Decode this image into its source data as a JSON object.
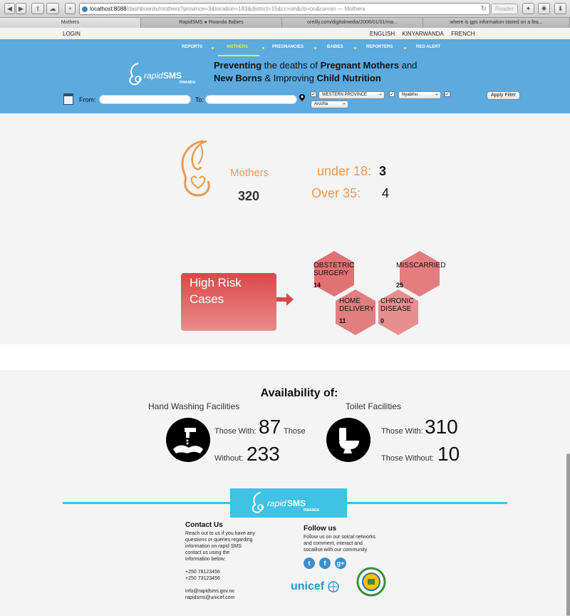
{
  "browser": {
    "url_host": "localhost:8088",
    "url_path": "/dashboards/mothers?province=3&location=183&district=15&cc=on&cb=on&ca=on",
    "page_title": "— Mothers",
    "reader_label": "Reader",
    "tabs": [
      {
        "label": "Mothers"
      },
      {
        "label": "RapidSMS ● Rwanda Babies"
      },
      {
        "label": "oreilly.com/digitalmedia/2006/01/01/ma..."
      },
      {
        "label": "where is gps information stored on a fea..."
      }
    ]
  },
  "topbar": {
    "login": "LOGIN",
    "languages": [
      "ENGLISH",
      "KINYARWANDA",
      "FRENCH"
    ]
  },
  "nav": {
    "items": [
      "REPORTS",
      "MOTHERS",
      "PREGNANCIES",
      "BABIES",
      "REPORTERS",
      "RED ALERT"
    ]
  },
  "logo": {
    "rapid": "rapid",
    "sms": "SMS",
    "rwanda": "RWANDA"
  },
  "tagline": {
    "w1": "Preventing",
    "w2": " the deaths of ",
    "w3": "Pregnant Mothers",
    "w4": " and",
    "w5": "New Borns",
    "w6": " & Improving ",
    "w7": "Child Nutrition"
  },
  "filters": {
    "from_label": "From:",
    "to_label": "To:",
    "from_value": "",
    "to_value": "",
    "province": "WESTERN PROVINCE",
    "district": "Nyabihu",
    "location": "Arusha",
    "apply_label": "Apply Filter"
  },
  "mothers": {
    "label": "Mothers",
    "count": "320",
    "under18_label": "under 18:",
    "under18_value": "3",
    "over35_label": "Over 35:",
    "over35_value": "4"
  },
  "high_risk": {
    "title_line1": "High Risk",
    "title_line2": "Cases",
    "cases": [
      {
        "l1": "OBSTETRIC",
        "l2": "SURGERY",
        "count": "14"
      },
      {
        "l1": "MISSCARRIED",
        "l2": "",
        "count": "25"
      },
      {
        "l1": "HOME",
        "l2": "DELIVERY",
        "count": "11"
      },
      {
        "l1": "CHRONIC",
        "l2": "DISEASE",
        "count": "0"
      }
    ]
  },
  "availability": {
    "title": "Availability of:",
    "hand_washing": {
      "title": "Hand Washing Facilities",
      "with_label": "Those With:",
      "with_value": "87",
      "with_trailing": "Those",
      "without_label": "Without:",
      "without_value": "233"
    },
    "toilet": {
      "title": "Toilet Facilities",
      "with_label": "Those With:",
      "with_value": "310",
      "without_label": "Those Without:",
      "without_value": "10"
    }
  },
  "footer": {
    "contact_title": "Contact Us",
    "contact_lines": [
      "Reach out to us if you have any",
      "questions or queries regarding",
      "information on rapid SMS",
      "contact us using the",
      "information below:",
      "",
      "+250 78123456",
      "+250 73123456",
      "",
      "info@rapidsms.gov.rw",
      "rapidsms@unicef.com"
    ],
    "follow_title": "Follow us",
    "follow_lines": [
      "Follow us on our soical networks",
      "and comment, interact and",
      "socailise with our community"
    ],
    "unicef": "unicef",
    "social": [
      "twitter-icon",
      "facebook-icon",
      "google-plus-icon"
    ]
  },
  "colors": {
    "header_blue": "#5baae0",
    "orange": "#ec9a53",
    "risk_red": "#d9484a",
    "footer_blue": "#3ec2e6"
  }
}
